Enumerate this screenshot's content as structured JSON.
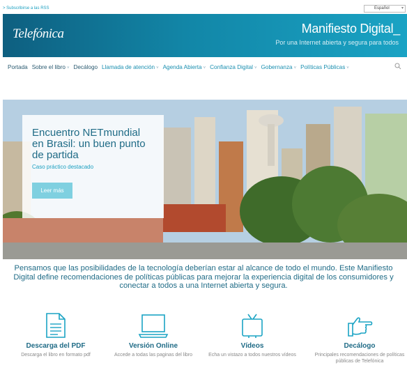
{
  "topbar": {
    "rss_link": "> Subscribirse a las RSS",
    "language": "Español"
  },
  "header": {
    "logo": "Telefónica",
    "title": "Manifiesto Digital_",
    "subtitle": "Por una Internet abierta y segura para todos"
  },
  "nav": {
    "items": [
      {
        "label": "Portada"
      },
      {
        "label": "Sobre el libro"
      },
      {
        "label": "Decálogo"
      },
      {
        "label": "Llamada de atención"
      },
      {
        "label": "Agenda Abierta"
      },
      {
        "label": "Confianza Digital"
      },
      {
        "label": "Gobernanza"
      },
      {
        "label": "Políticas Públicas"
      }
    ]
  },
  "hero": {
    "title": "Encuentro NETmundial en Brasil: un buen punto de partida",
    "subtitle": "Caso práctico destacado",
    "button": "Leer más"
  },
  "intro": {
    "line1": "Pensamos que las posibilidades de la tecnología deberían estar al alcance de todo el mundo. Este Manifiesto",
    "line2": "Digital define recomendaciones de políticas públicas para mejorar la experiencia digital de los consumidores y",
    "line3": "conectar a todos a una Internet abierta y segura."
  },
  "features": [
    {
      "title": "Descarga del PDF",
      "desc": "Descarga el libro en formato pdf",
      "icon": "document-icon"
    },
    {
      "title": "Versión Online",
      "desc": "Accede a todas las paginas del libro",
      "icon": "laptop-icon"
    },
    {
      "title": "Vídeos",
      "desc": "Echa un vistazo a todos nuestros vídeos",
      "icon": "tv-icon"
    },
    {
      "title": "Decálogo",
      "desc": "Principales recomendaciones de políticas públicas de Telefónica",
      "icon": "pointing-hand-icon"
    }
  ],
  "colors": {
    "accent": "#1a9fc0",
    "header_dark": "#0e5f80",
    "title_blue": "#1f6b86",
    "button": "#7fd0e0"
  }
}
